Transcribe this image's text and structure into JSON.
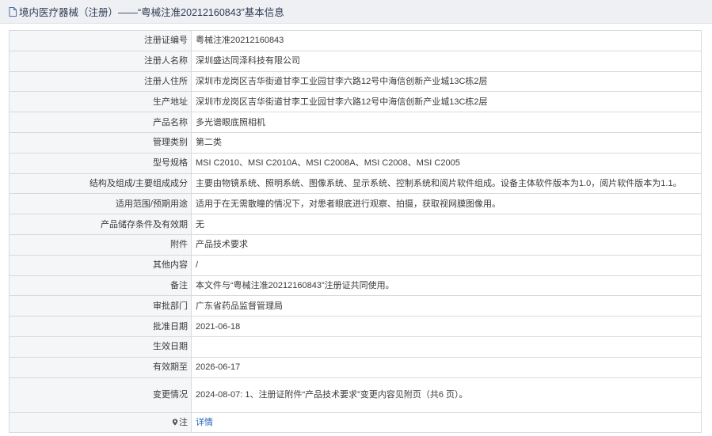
{
  "header": {
    "title": "境内医疗器械（注册）——“粤械注准20212160843”基本信息",
    "icon": "document-icon"
  },
  "rows": [
    {
      "label": "注册证编号",
      "value": "粤械注准20212160843"
    },
    {
      "label": "注册人名称",
      "value": "深圳盛达同泽科技有限公司"
    },
    {
      "label": "注册人住所",
      "value": "深圳市龙岗区吉华街道甘李工业园甘李六路12号中海信创新产业城13C栋2层"
    },
    {
      "label": "生产地址",
      "value": "深圳市龙岗区吉华街道甘李工业园甘李六路12号中海信创新产业城13C栋2层"
    },
    {
      "label": "产品名称",
      "value": "多光谱眼底照相机"
    },
    {
      "label": "管理类别",
      "value": "第二类"
    },
    {
      "label": "型号规格",
      "value": "MSI C2010、MSI C2010A、MSI C2008A、MSI C2008、MSI C2005"
    },
    {
      "label": "结构及组成/主要组成成分",
      "value": "主要由物镜系统、照明系统、图像系统、显示系统、控制系统和阅片软件组成。设备主体软件版本为1.0，阅片软件版本为1.1。"
    },
    {
      "label": "适用范围/预期用途",
      "value": "适用于在无需散瞳的情况下，对患者眼底进行观察、拍摄，获取视网膜图像用。"
    },
    {
      "label": "产品储存条件及有效期",
      "value": "无"
    },
    {
      "label": "附件",
      "value": "产品技术要求"
    },
    {
      "label": "其他内容",
      "value": "/"
    },
    {
      "label": "备注",
      "value": "本文件与“粤械注准20212160843”注册证共同使用。"
    },
    {
      "label": "审批部门",
      "value": "广东省药品监督管理局"
    },
    {
      "label": "批准日期",
      "value": "2021-06-18"
    },
    {
      "label": "生效日期",
      "value": ""
    },
    {
      "label": "有效期至",
      "value": "2026-06-17"
    },
    {
      "label": "变更情况",
      "value": "2024-08-07: 1、注册证附件“产品技术要求”变更内容见附页（共6 页）。"
    }
  ],
  "note_row": {
    "label": "注",
    "link_text": "详情",
    "icon": "location-pin-icon"
  },
  "colors": {
    "header_bg": "#eef0f4",
    "label_bg": "#f5f6f8",
    "border": "#d6dae0",
    "link": "#2266bb"
  }
}
